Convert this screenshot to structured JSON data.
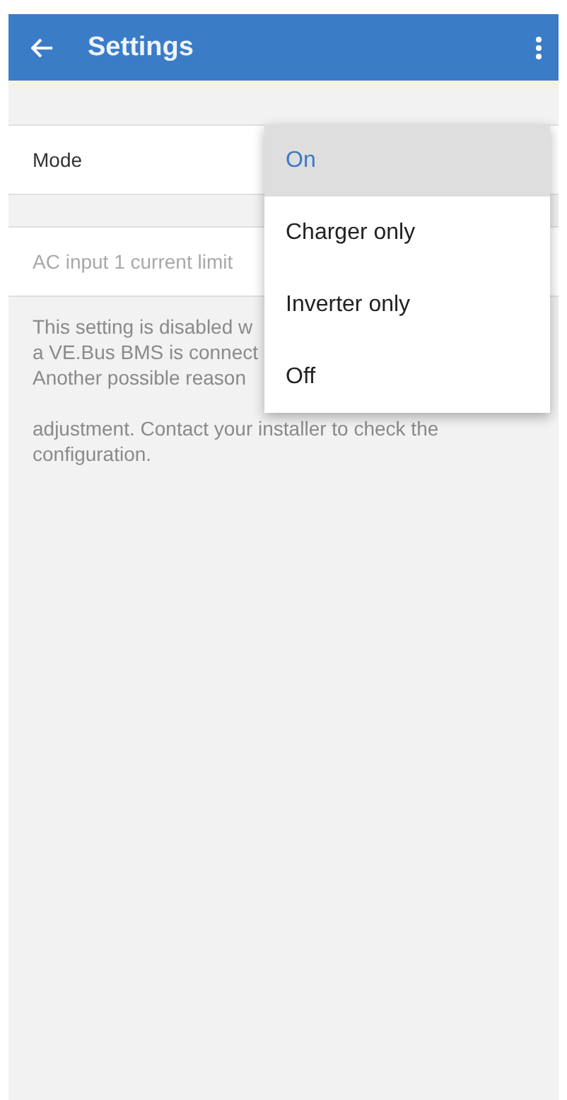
{
  "app_bar": {
    "title": "Settings"
  },
  "rows": [
    {
      "label": "Mode",
      "disabled": false
    },
    {
      "label": "AC input 1 current limit",
      "disabled": true
    }
  ],
  "note_lines": [
    "This setting is disabled w",
    "a VE.Bus BMS is connect",
    "Another possible reason",
    "adjustment. Contact your installer to check the",
    "configuration."
  ],
  "menu": [
    {
      "label": "On",
      "selected": true
    },
    {
      "label": "Charger only",
      "selected": false
    },
    {
      "label": "Inverter only",
      "selected": false
    },
    {
      "label": "Off",
      "selected": false
    }
  ]
}
